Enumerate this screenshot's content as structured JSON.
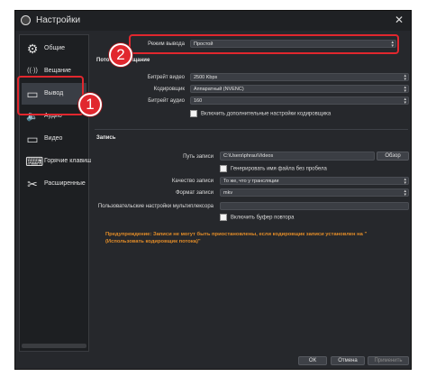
{
  "window": {
    "title": "Настройки",
    "close_glyph": "✕"
  },
  "sidebar": {
    "items": [
      {
        "label": "Общие",
        "icon": "gear-icon",
        "glyph": "⚙"
      },
      {
        "label": "Вещание",
        "icon": "broadcast-icon",
        "glyph": "((·))"
      },
      {
        "label": "Вывод",
        "icon": "output-icon",
        "glyph": "▭"
      },
      {
        "label": "Аудио",
        "icon": "speaker-icon",
        "glyph": "🔈"
      },
      {
        "label": "Видео",
        "icon": "monitor-icon",
        "glyph": "▭"
      },
      {
        "label": "Горячие клавиши",
        "icon": "keyboard-icon",
        "glyph": "⌨"
      },
      {
        "label": "Расширенные",
        "icon": "tools-icon",
        "glyph": "✂"
      }
    ],
    "active_index": 2
  },
  "output": {
    "mode_label": "Режим вывода",
    "mode_value": "Простой",
    "streaming": {
      "title": "Потоковое вещание",
      "video_bitrate_label": "Битрейт видео",
      "video_bitrate_value": "2500 Kbps",
      "encoder_label": "Кодировщик",
      "encoder_value": "Аппаратный (NVENC)",
      "audio_bitrate_label": "Битрейт аудио",
      "audio_bitrate_value": "160",
      "advanced_encoder_check": "Включить дополнительные настройки кодировщика"
    },
    "recording": {
      "title": "Запись",
      "path_label": "Путь записи",
      "path_value": "C:\\Users\\phrau\\Videos",
      "browse_button": "Обзор",
      "no_space_check": "Генерировать имя файла без пробела",
      "quality_label": "Качество записи",
      "quality_value": "То же, что у трансляции",
      "format_label": "Формат записи",
      "format_value": "mkv",
      "muxer_label": "Пользовательские настройки мультиплексора",
      "muxer_value": "",
      "replay_check": "Включить буфер повтора"
    },
    "warning": "Предупреждение: Записи не могут быть приостановлены, если кодировщик записи установлен на \"(Использовать кодировщик потока)\""
  },
  "footer": {
    "ok": "ОК",
    "cancel": "Отмена",
    "apply": "Применить"
  },
  "annotations": {
    "step1": "1",
    "step2": "2",
    "color": "#e1272e"
  }
}
